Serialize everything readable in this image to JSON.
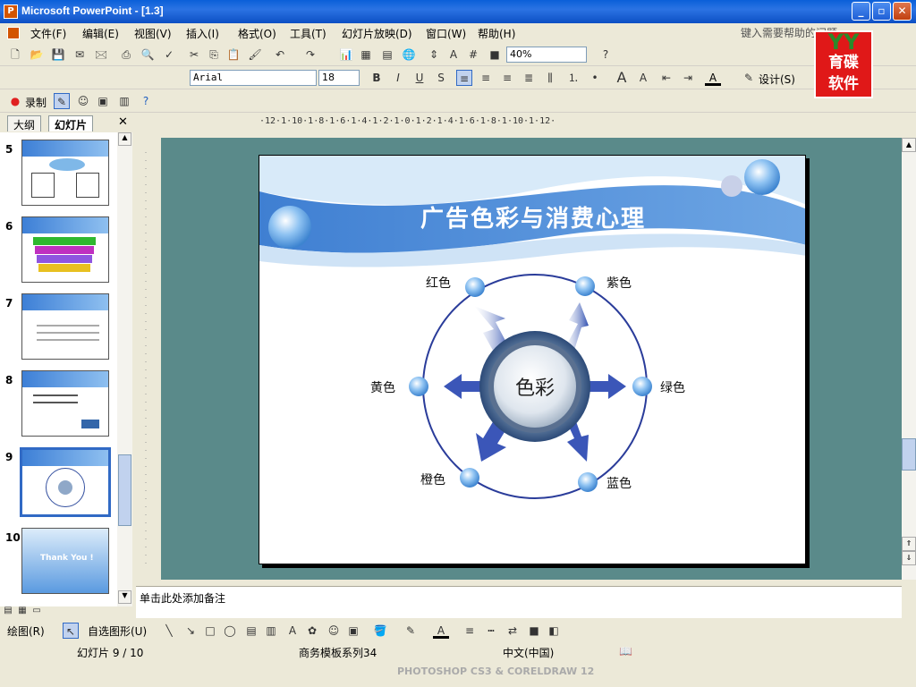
{
  "window": {
    "title": "Microsoft PowerPoint - [1.3]",
    "app_icon": "P"
  },
  "menu": [
    {
      "label": "文件(F)"
    },
    {
      "label": "编辑(E)"
    },
    {
      "label": "视图(V)"
    },
    {
      "label": "插入(I)"
    },
    {
      "label": "格式(O)"
    },
    {
      "label": "工具(T)"
    },
    {
      "label": "幻灯片放映(D)"
    },
    {
      "label": "窗口(W)"
    },
    {
      "label": "帮助(H)"
    }
  ],
  "help_box": {
    "placeholder": "键入需要帮助的问题"
  },
  "toolbar": {
    "zoom": "40%",
    "font": "Arial",
    "font_size": "18",
    "design_label": "设计(S)",
    "record_label": "录制"
  },
  "logo": {
    "top": "YY",
    "line1": "育碟",
    "line2": "软件"
  },
  "panel_tabs": {
    "outline": "大纲",
    "slides": "幻灯片"
  },
  "thumbs": [
    {
      "num": "5"
    },
    {
      "num": "6"
    },
    {
      "num": "7"
    },
    {
      "num": "8"
    },
    {
      "num": "9"
    },
    {
      "num": "10",
      "text": "Thank You !"
    }
  ],
  "ruler": {
    "h": "·12·1·10·1·8·1·6·1·4·1·2·1·0·1·2·1·4·1·6·1·8·1·10·1·12·"
  },
  "slide": {
    "title": "广告色彩与消费心理",
    "center": "色彩",
    "colors": [
      "红色",
      "紫色",
      "绿色",
      "蓝色",
      "橙色",
      "黄色"
    ]
  },
  "notes": {
    "placeholder": "单击此处添加备注"
  },
  "drawbar": {
    "draw": "绘图(R)",
    "autoshape": "自选图形(U)"
  },
  "status": {
    "slide": "幻灯片 9 / 10",
    "template": "商务模板系列34",
    "lang": "中文(中国)"
  },
  "watermark": "PHOTOSHOP CS3 & CORELDRAW 12"
}
